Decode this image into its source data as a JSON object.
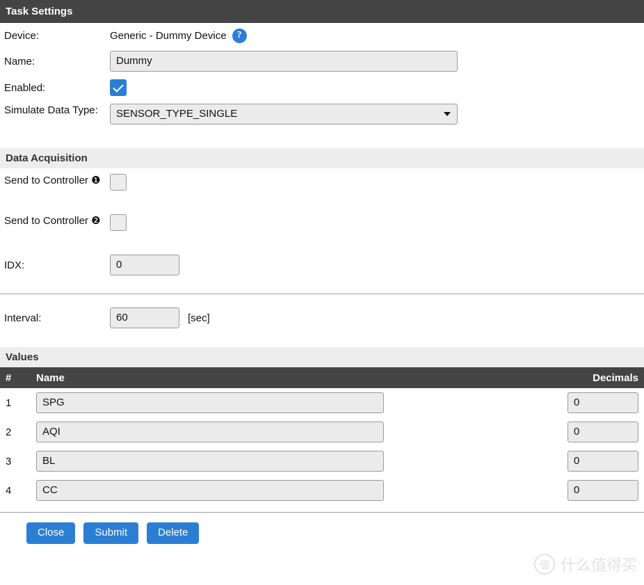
{
  "window": {
    "title": "Task Settings"
  },
  "device_section": {
    "device_label": "Device:",
    "device_value": "Generic - Dummy Device",
    "help_icon": "help-icon",
    "name_label": "Name:",
    "name_value": "Dummy",
    "enabled_label": "Enabled:",
    "enabled_checked": true,
    "simulate_label": "Simulate Data Type:",
    "simulate_value": "SENSOR_TYPE_SINGLE",
    "caret_icon": "chevron-down-icon"
  },
  "data_acquisition": {
    "heading": "Data Acquisition",
    "controller1_label": "Send to Controller ❶",
    "controller1_checked": false,
    "controller2_label": "Send to Controller ❷",
    "controller2_checked": false,
    "idx_label": "IDX:",
    "idx_value": "0"
  },
  "interval_section": {
    "label": "Interval:",
    "value": "60",
    "unit": "[sec]"
  },
  "values_section": {
    "heading": "Values",
    "columns": {
      "index": "#",
      "name": "Name",
      "decimals": "Decimals"
    },
    "rows": [
      {
        "index": "1",
        "name": "SPG",
        "decimals": "0"
      },
      {
        "index": "2",
        "name": "AQI",
        "decimals": "0"
      },
      {
        "index": "3",
        "name": "BL",
        "decimals": "0"
      },
      {
        "index": "4",
        "name": "CC",
        "decimals": "0"
      }
    ]
  },
  "buttons": {
    "close": "Close",
    "submit": "Submit",
    "delete": "Delete"
  },
  "watermark": {
    "logo": "值",
    "text": "什么值得买"
  },
  "colors": {
    "titlebar": "#444444",
    "accent": "#2a7fd4",
    "section_bg": "#ededed",
    "input_bg": "#ebebeb"
  }
}
